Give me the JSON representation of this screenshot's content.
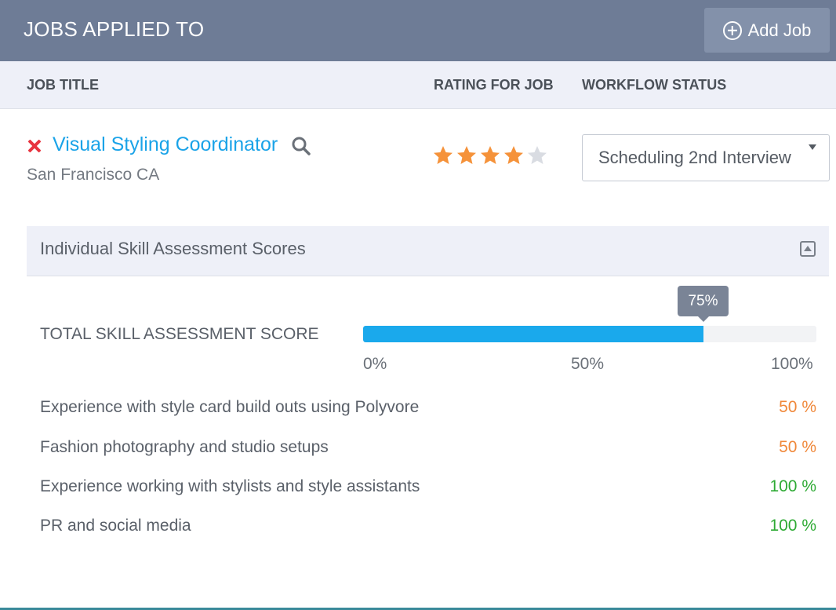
{
  "header": {
    "title": "JOBS APPLIED TO",
    "add_button_label": "Add Job"
  },
  "columns": {
    "job_title": "JOB TITLE",
    "rating": "RATING FOR JOB",
    "workflow_status": "WORKFLOW STATUS"
  },
  "job": {
    "title": "Visual Styling Coordinator",
    "location": "San Francisco CA",
    "rating": 4,
    "rating_max": 5,
    "workflow_status": "Scheduling 2nd Interview"
  },
  "skills": {
    "panel_title": "Individual Skill Assessment Scores",
    "total_label": "TOTAL SKILL ASSESSMENT SCORE",
    "total_percent": 75,
    "total_tooltip": "75%",
    "scale": {
      "min": "0%",
      "mid": "50%",
      "max": "100%"
    },
    "items": [
      {
        "name": "Experience with style card build outs using Polyvore",
        "score": "50 %",
        "color": "#f0883a"
      },
      {
        "name": "Fashion photography and studio setups",
        "score": "50 %",
        "color": "#f0883a"
      },
      {
        "name": "Experience working with stylists and style assistants",
        "score": "100 %",
        "color": "#2eaa34"
      },
      {
        "name": "PR and social media",
        "score": "100 %",
        "color": "#2eaa34"
      }
    ]
  },
  "colors": {
    "header_bg": "#6e7c96",
    "accent_blue": "#1aa9ec",
    "star_filled": "#f5923a",
    "star_empty": "#d9dce2",
    "remove_red": "#e8333e"
  }
}
